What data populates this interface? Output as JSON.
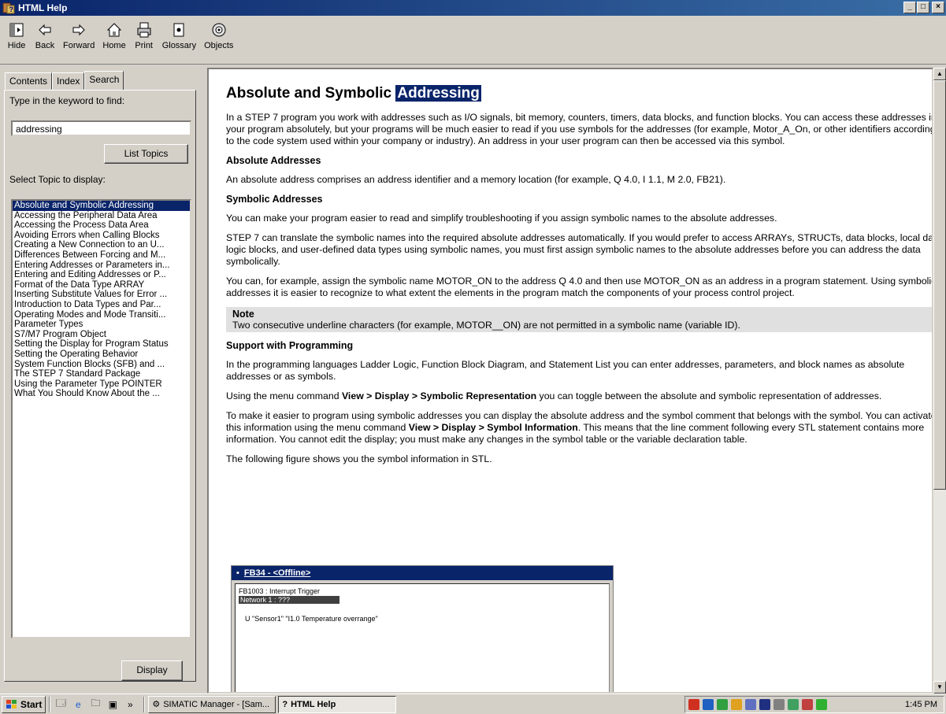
{
  "window": {
    "title": "HTML Help",
    "controls": [
      "_",
      "□",
      "×"
    ]
  },
  "toolbar": {
    "buttons": [
      {
        "label": "Hide",
        "icon": "hide-icon"
      },
      {
        "label": "Back",
        "icon": "back-arrow-icon"
      },
      {
        "label": "Forward",
        "icon": "forward-arrow-icon"
      },
      {
        "label": "Home",
        "icon": "home-icon"
      },
      {
        "label": "Print",
        "icon": "printer-icon"
      },
      {
        "label": "Glossary",
        "icon": "glossary-icon"
      },
      {
        "label": "Objects",
        "icon": "objects-icon"
      }
    ]
  },
  "left": {
    "tabs": [
      "Contents",
      "Index",
      "Search"
    ],
    "active_tab": "Search",
    "keyword_label": "Type in the keyword to find:",
    "keyword_value": "addressing",
    "list_button": "List Topics",
    "select_label": "Select Topic to display:",
    "topics": [
      "Absolute and Symbolic Addressing",
      "Accessing the Peripheral Data Area",
      "Accessing the Process Data Area",
      "Avoiding Errors when Calling Blocks",
      "Creating a New Connection to an U...",
      "Differences Between Forcing and M...",
      "Entering Addresses or Parameters in...",
      "Entering and Editing Addresses or P...",
      "Format of the Data Type ARRAY",
      "Inserting Substitute Values for Error ...",
      "Introduction to Data Types and Par...",
      "Operating Modes and Mode Transiti...",
      "Parameter Types",
      "S7/M7 Program Object",
      "Setting the Display for Program Status",
      "Setting the Operating Behavior",
      "System Function Blocks (SFB) and ...",
      "The STEP 7 Standard Package",
      "Using the Parameter Type POINTER",
      "What You Should Know About the ..."
    ],
    "selected_topic_index": 0,
    "display_button": "Display"
  },
  "content": {
    "title_prefix": "Absolute and Symbolic ",
    "title_highlight": "Addressing",
    "intro": "In a STEP 7 program you work with addresses such as I/O signals, bit memory, counters, timers, data blocks, and function blocks. You can access these addresses in your program absolutely, but your programs will be much easier to read if you use symbols for the addresses (for example, Motor_A_On, or other identifiers according to the code system used within your company or industry). An address in your user program can then be accessed via this symbol.",
    "h_absolute": "Absolute Addresses",
    "p_absolute": "An absolute address comprises an address identifier and a memory location (for example, Q 4.0, I 1.1, M 2.0, FB21).",
    "h_symbolic": "Symbolic Addresses",
    "p_symbolic1": "You can make your program easier to read and simplify troubleshooting if you assign symbolic names to the absolute addresses.",
    "p_symbolic2": "STEP 7 can translate the symbolic names into the required absolute addresses automatically. If you would prefer to access ARRAYs, STRUCTs, data blocks, local data, logic blocks, and user-defined data types using symbolic names, you must first assign symbolic names to the absolute addresses before you can address the data symbolically.",
    "p_symbolic3": "You can, for example, assign the symbolic name MOTOR_ON to the address Q 4.0 and then use MOTOR_ON as an address in a program statement. Using symbolic addresses it is easier to recognize to what extent the elements in the program match the components of your process control project.",
    "note_title": "Note",
    "note_body": "Two consecutive underline characters (for example, MOTOR__ON) are not permitted in a symbolic name (variable ID).",
    "h_support": "Support with Programming",
    "p_support1": "In the programming languages Ladder Logic, Function Block Diagram, and Statement List you can enter addresses, parameters, and block names as absolute addresses or as symbols.",
    "p_support2_a": "Using the menu command ",
    "p_support2_b": "View > Display > Symbolic Representation",
    "p_support2_c": " you can toggle between the absolute and symbolic representation of addresses.",
    "p_support3_a": "To make it easier to program using symbolic addresses you can display the absolute address and the symbol comment that belongs with the symbol. You can activate this information using the menu command ",
    "p_support3_b": "View > Display > Symbol Information",
    "p_support3_c": ". This means that the line comment following every STL statement contains more information. You cannot edit the display; you must make any changes in the symbol table or the variable declaration table.",
    "p_figure": "The following figure shows you the symbol information in STL.",
    "figure": {
      "window_title": "FB34 - <Offline>",
      "block": "FB1003 : Interrupt Trigger",
      "network": "Network 1 : ???",
      "line": "U   \"Sensor1\"   \"I1.0   Temperature overrange\""
    }
  },
  "taskbar": {
    "start": "Start",
    "more": "»",
    "tasks": [
      {
        "label": "SIMATIC Manager - [Sam...",
        "active": false
      },
      {
        "label": "HTML Help",
        "active": true
      }
    ],
    "clock": "1:45 PM"
  },
  "colors": {
    "titlebar": "#0a246a",
    "selection": "#0a246a",
    "chrome": "#d4d0c8"
  }
}
